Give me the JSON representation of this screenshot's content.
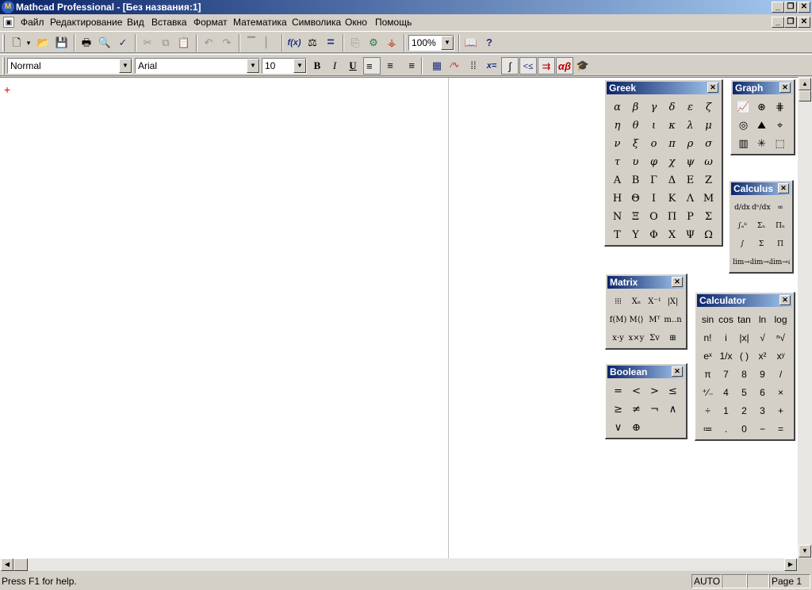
{
  "window": {
    "title": "Mathcad Professional - [Без названия:1]",
    "app_icon": "mathcad-icon",
    "buttons": [
      "minimize",
      "restore",
      "close"
    ]
  },
  "menubar": {
    "items": [
      "Файл",
      "Редактирование",
      "Вид",
      "Вставка",
      "Формат",
      "Математика",
      "Символика",
      "Окно",
      "Помощь"
    ]
  },
  "standard_toolbar": {
    "buttons": [
      {
        "name": "new-icon",
        "glyph": "🗋"
      },
      {
        "name": "new-dropdown-icon",
        "glyph": "▾"
      },
      {
        "name": "open-icon",
        "glyph": "📂"
      },
      {
        "name": "save-icon",
        "glyph": "💾"
      },
      {
        "name": "print-icon",
        "glyph": "🖶"
      },
      {
        "name": "print-preview-icon",
        "glyph": "🔍"
      },
      {
        "name": "spell-check-icon",
        "glyph": "✓"
      },
      {
        "name": "cut-icon",
        "glyph": "✂"
      },
      {
        "name": "copy-icon",
        "glyph": "⧉"
      },
      {
        "name": "paste-icon",
        "glyph": "📋"
      },
      {
        "name": "undo-icon",
        "glyph": "↶"
      },
      {
        "name": "redo-icon",
        "glyph": "↷"
      },
      {
        "name": "align-across-icon",
        "glyph": "▔"
      },
      {
        "name": "align-down-icon",
        "glyph": "▏"
      },
      {
        "name": "insert-function-icon",
        "glyph": "f(x)"
      },
      {
        "name": "insert-unit-icon",
        "glyph": "⚖"
      },
      {
        "name": "calculate-icon",
        "glyph": "="
      },
      {
        "name": "insert-component-icon",
        "glyph": "⎘"
      },
      {
        "name": "run-mathconnex-icon",
        "glyph": "⚙"
      },
      {
        "name": "resource-icon",
        "glyph": "⚶"
      },
      {
        "name": "resource-center-icon",
        "glyph": "📖"
      },
      {
        "name": "help-icon",
        "glyph": "?"
      }
    ],
    "zoom": "100%"
  },
  "format_toolbar": {
    "style": "Normal",
    "font": "Arial",
    "size": "10",
    "buttons": [
      {
        "name": "bold-icon",
        "glyph": "B"
      },
      {
        "name": "italic-icon",
        "glyph": "I"
      },
      {
        "name": "underline-icon",
        "glyph": "U"
      },
      {
        "name": "align-left-icon",
        "glyph": "≡"
      },
      {
        "name": "align-center-icon",
        "glyph": "≡"
      },
      {
        "name": "align-right-icon",
        "glyph": "≡"
      }
    ],
    "math_buttons": [
      {
        "name": "calculator-toolbar-icon",
        "glyph": "▦"
      },
      {
        "name": "graph-toolbar-icon",
        "glyph": "∕∿"
      },
      {
        "name": "matrix-toolbar-icon",
        "glyph": "⁞⁞"
      },
      {
        "name": "evaluation-toolbar-icon",
        "glyph": "x="
      },
      {
        "name": "calculus-toolbar-icon",
        "glyph": "∫"
      },
      {
        "name": "boolean-toolbar-icon",
        "glyph": "<≤"
      },
      {
        "name": "programming-toolbar-icon",
        "glyph": "⇉"
      },
      {
        "name": "greek-toolbar-icon",
        "glyph": "αβ"
      },
      {
        "name": "symbolic-toolbar-icon",
        "glyph": "🎓"
      }
    ]
  },
  "palettes": {
    "greek": {
      "title": "Greek",
      "lower": [
        "α",
        "β",
        "γ",
        "δ",
        "ε",
        "ζ",
        "η",
        "θ",
        "ι",
        "κ",
        "λ",
        "μ",
        "ν",
        "ξ",
        "ο",
        "π",
        "ρ",
        "σ",
        "τ",
        "υ",
        "φ",
        "χ",
        "ψ",
        "ω"
      ],
      "upper": [
        "Α",
        "Β",
        "Γ",
        "Δ",
        "Ε",
        "Ζ",
        "Η",
        "Θ",
        "Ι",
        "Κ",
        "Λ",
        "Μ",
        "Ν",
        "Ξ",
        "Ο",
        "Π",
        "Ρ",
        "Σ",
        "Τ",
        "Υ",
        "Φ",
        "Χ",
        "Ψ",
        "Ω"
      ]
    },
    "graph": {
      "title": "Graph",
      "icons": [
        {
          "name": "xy-plot-icon",
          "glyph": "📈"
        },
        {
          "name": "polar-plot-icon",
          "glyph": "⊛"
        },
        {
          "name": "surface-plot-icon",
          "glyph": "⋕"
        },
        {
          "name": "contour-plot-icon",
          "glyph": "◎"
        },
        {
          "name": "3d-scatter-plot-icon",
          "glyph": "⛰"
        },
        {
          "name": "vector-field-icon",
          "glyph": "⌖"
        },
        {
          "name": "3d-bar-plot-icon",
          "glyph": "▥"
        },
        {
          "name": "zoom-plot-icon",
          "glyph": "✳"
        },
        {
          "name": "trace-plot-icon",
          "glyph": "⬚"
        }
      ]
    },
    "calculus": {
      "title": "Calculus",
      "items": [
        "d/dx",
        "dⁿ/dxⁿ",
        "∞",
        "∫ₐᵇ",
        "Σₙ",
        "Πₙ",
        "∫",
        "Σ",
        "Π",
        "lim→a",
        "lim→a+",
        "lim→a-"
      ]
    },
    "matrix": {
      "title": "Matrix",
      "items": [
        "⁞⁞⁞",
        "Xₙ",
        "X⁻¹",
        "|X|",
        "f(M)",
        "M⟨⟩",
        "Mᵀ",
        "m..n",
        "x·y",
        "x×y",
        "Σv",
        "⊞"
      ]
    },
    "boolean": {
      "title": "Boolean",
      "items": [
        "=",
        "<",
        ">",
        "≤",
        "≥",
        "≠",
        "¬",
        "∧",
        "∨",
        "⊕"
      ]
    },
    "calculator": {
      "title": "Calculator",
      "items": [
        "sin",
        "cos",
        "tan",
        "ln",
        "log",
        "n!",
        "i",
        "|x|",
        "√",
        "ⁿ√",
        "eˣ",
        "1/x",
        "( )",
        "x²",
        "xʸ",
        "π",
        "7",
        "8",
        "9",
        "/",
        "⁺⁄₋",
        "4",
        "5",
        "6",
        "×",
        "÷",
        "1",
        "2",
        "3",
        "+",
        "≔",
        ".",
        "0",
        "−",
        "="
      ]
    }
  },
  "status": {
    "help": "Press F1 for help.",
    "mode": "AUTO",
    "page": "Page 1"
  }
}
